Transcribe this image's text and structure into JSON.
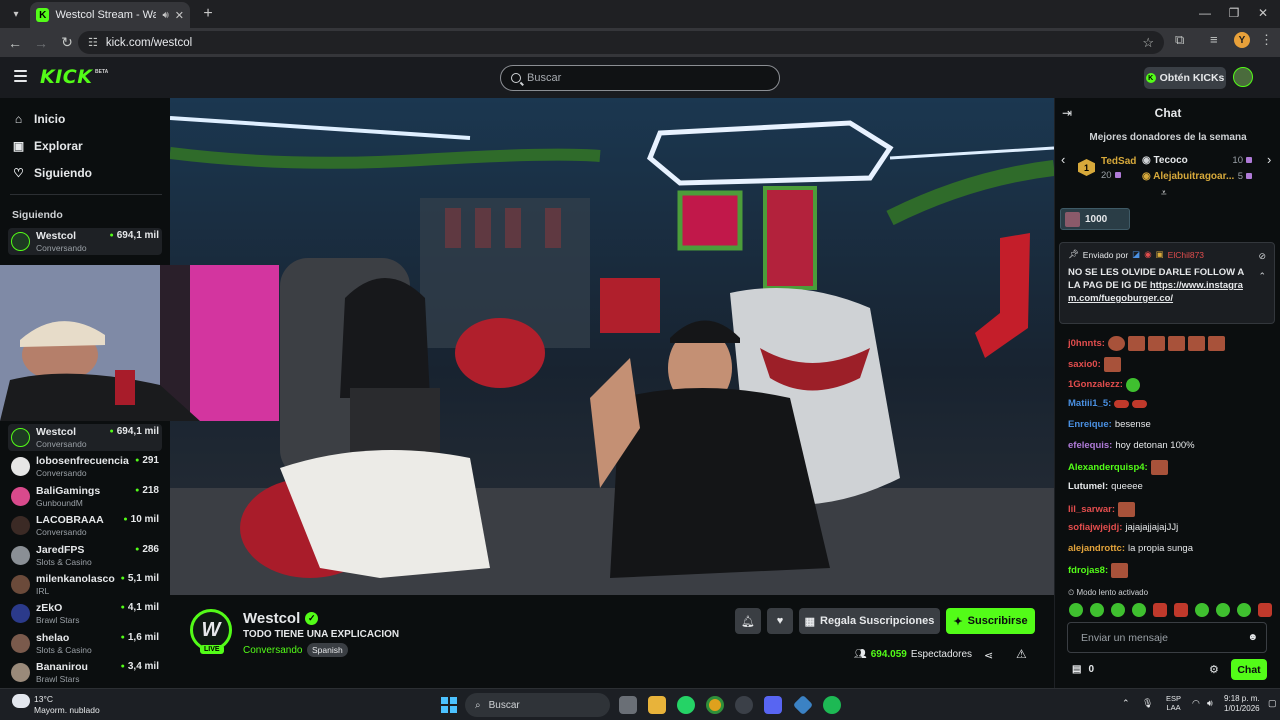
{
  "browser": {
    "tab_title": "Westcol Stream - Watch Live",
    "tab_favicon": "K",
    "url": "kick.com/westcol",
    "profile_initial": "Y"
  },
  "header": {
    "logo": "KICK",
    "beta": "BETA",
    "search_placeholder": "Buscar",
    "kicks_button": "Obtén KICKs"
  },
  "sidebar": {
    "nav": [
      {
        "label": "Inicio",
        "icon": "home-icon"
      },
      {
        "label": "Explorar",
        "icon": "compass-icon"
      },
      {
        "label": "Siguiendo",
        "icon": "heart-icon"
      }
    ],
    "following_heading": "Siguiendo",
    "following": [
      {
        "name": "Westcol",
        "sub": "Conversando",
        "viewers": "694,1 mil"
      }
    ],
    "recommended": [
      {
        "name": "Westcol",
        "sub": "Conversando",
        "viewers": "694,1 mil"
      },
      {
        "name": "lobosenfrecuencia",
        "sub": "Conversando",
        "viewers": "291"
      },
      {
        "name": "BaliGamings",
        "sub": "GunboundM",
        "viewers": "218"
      },
      {
        "name": "LACOBRAAA",
        "sub": "Conversando",
        "viewers": "10 mil"
      },
      {
        "name": "JaredFPS",
        "sub": "Slots & Casino",
        "viewers": "286"
      },
      {
        "name": "milenkanolasco",
        "sub": "IRL",
        "viewers": "5,1 mil"
      },
      {
        "name": "zEkO",
        "sub": "Brawl Stars",
        "viewers": "4,1 mil"
      },
      {
        "name": "shelao",
        "sub": "Slots & Casino",
        "viewers": "1,6 mil"
      },
      {
        "name": "Bananirou",
        "sub": "Brawl Stars",
        "viewers": "3,4 mil"
      }
    ]
  },
  "channel": {
    "name": "Westcol",
    "live": "LIVE",
    "title": "TODO TIENE UNA EXPLICACION",
    "category": "Conversando",
    "tag": "Spanish",
    "gift_button": "Regala Suscripciones",
    "subscribe_button": "Suscribirse",
    "viewers": "694.059",
    "viewers_label": "Espectadores"
  },
  "chat": {
    "title": "Chat",
    "donors_title": "Mejores donadores de la semana",
    "donors": [
      {
        "rank": "1",
        "name": "TedSad",
        "amount": "20"
      },
      {
        "name": "Tecoco",
        "amount": "10"
      },
      {
        "name": "Alejabuitragoar...",
        "amount": "5"
      }
    ],
    "goal": "1000",
    "pinned": {
      "sent_by": "Enviado por",
      "user": "ElChil873",
      "message": "NO SE LES OLVIDE DARLE FOLLOW A LA PAG DE IG DE",
      "link": "https://www.instagram.com/fuegoburger.co/"
    },
    "messages": [
      {
        "user": "j0hnnts:",
        "text": "",
        "color": "#e24d4d"
      },
      {
        "user": "saxio0:",
        "text": "",
        "color": "#e24d4d"
      },
      {
        "user": "1Gonzalezz:",
        "text": "",
        "color": "#e24d4d"
      },
      {
        "user": "Matiii1_5:",
        "text": "",
        "color": "#4a90e2"
      },
      {
        "user": "Enreique:",
        "text": "besense",
        "color": "#4a90e2"
      },
      {
        "user": "efelequis:",
        "text": "hoy detonan 100%",
        "color": "#b07bd8"
      },
      {
        "user": "Alexanderquisp4:",
        "text": "",
        "color": "#53fc18"
      },
      {
        "user": "Lutumel:",
        "text": "queeee",
        "color": "#e6e8ea"
      },
      {
        "user": "lil_sarwar:",
        "text": "",
        "color": "#e24d4d"
      },
      {
        "user": "sofiajwjejdj:",
        "text": "jajajajjajajJJj",
        "color": "#e24d4d"
      },
      {
        "user": "alejandrottc:",
        "text": "la propia sunga",
        "color": "#e2a33b"
      },
      {
        "user": "fdrojas8:",
        "text": "",
        "color": "#53fc18"
      }
    ],
    "slow_mode": "Modo lento activado",
    "input_placeholder": "Enviar un mensaje",
    "points": "0",
    "send_button": "Chat"
  },
  "taskbar": {
    "temp": "13°C",
    "weather": "Mayorm. nublado",
    "search": "Buscar",
    "lang_top": "ESP",
    "lang_bottom": "LAA",
    "time": "9:18 p. m.",
    "date": "1/01/2026"
  }
}
